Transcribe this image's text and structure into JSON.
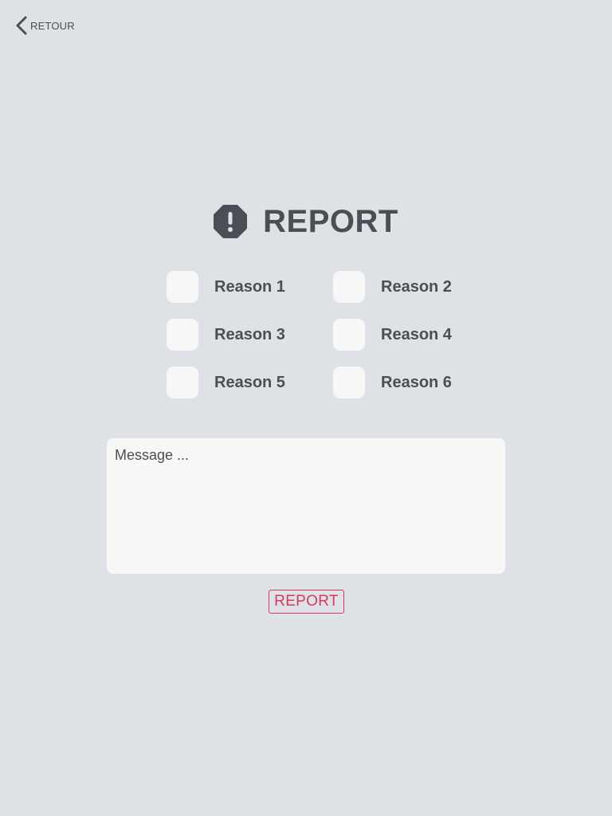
{
  "nav": {
    "back_label": "RETOUR",
    "back_icon": "chevron-left-icon"
  },
  "header": {
    "title": "REPORT",
    "icon": "alert-octagon-icon"
  },
  "reasons": [
    {
      "label": "Reason 1",
      "checked": false
    },
    {
      "label": "Reason 2",
      "checked": false
    },
    {
      "label": "Reason 3",
      "checked": false
    },
    {
      "label": "Reason 4",
      "checked": false
    },
    {
      "label": "Reason 5",
      "checked": false
    },
    {
      "label": "Reason 6",
      "checked": false
    }
  ],
  "message": {
    "value": "",
    "placeholder": "Message ..."
  },
  "actions": {
    "submit_label": "REPORT"
  },
  "colors": {
    "background": "#dee1e5",
    "text": "#4a4f55",
    "field": "#f7f7f7",
    "accent": "#d5395d"
  }
}
